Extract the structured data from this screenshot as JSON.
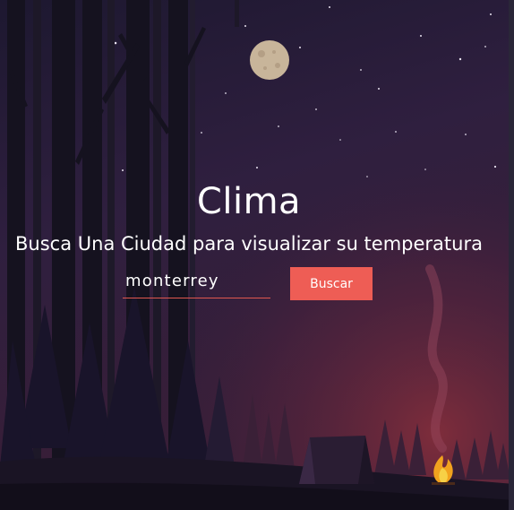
{
  "header": {
    "title": "Clima",
    "subtitle": "Busca Una Ciudad para visualizar su temperatura"
  },
  "search": {
    "value": "monterrey",
    "placeholder": "",
    "button_label": "Buscar"
  },
  "colors": {
    "accent": "#ee5d55",
    "input_underline": "#e0574f",
    "text": "#ffffff",
    "moon": "#c8b59a"
  },
  "icons": {
    "moon": "moon-icon",
    "campfire": "campfire-icon",
    "tent": "tent-icon"
  }
}
